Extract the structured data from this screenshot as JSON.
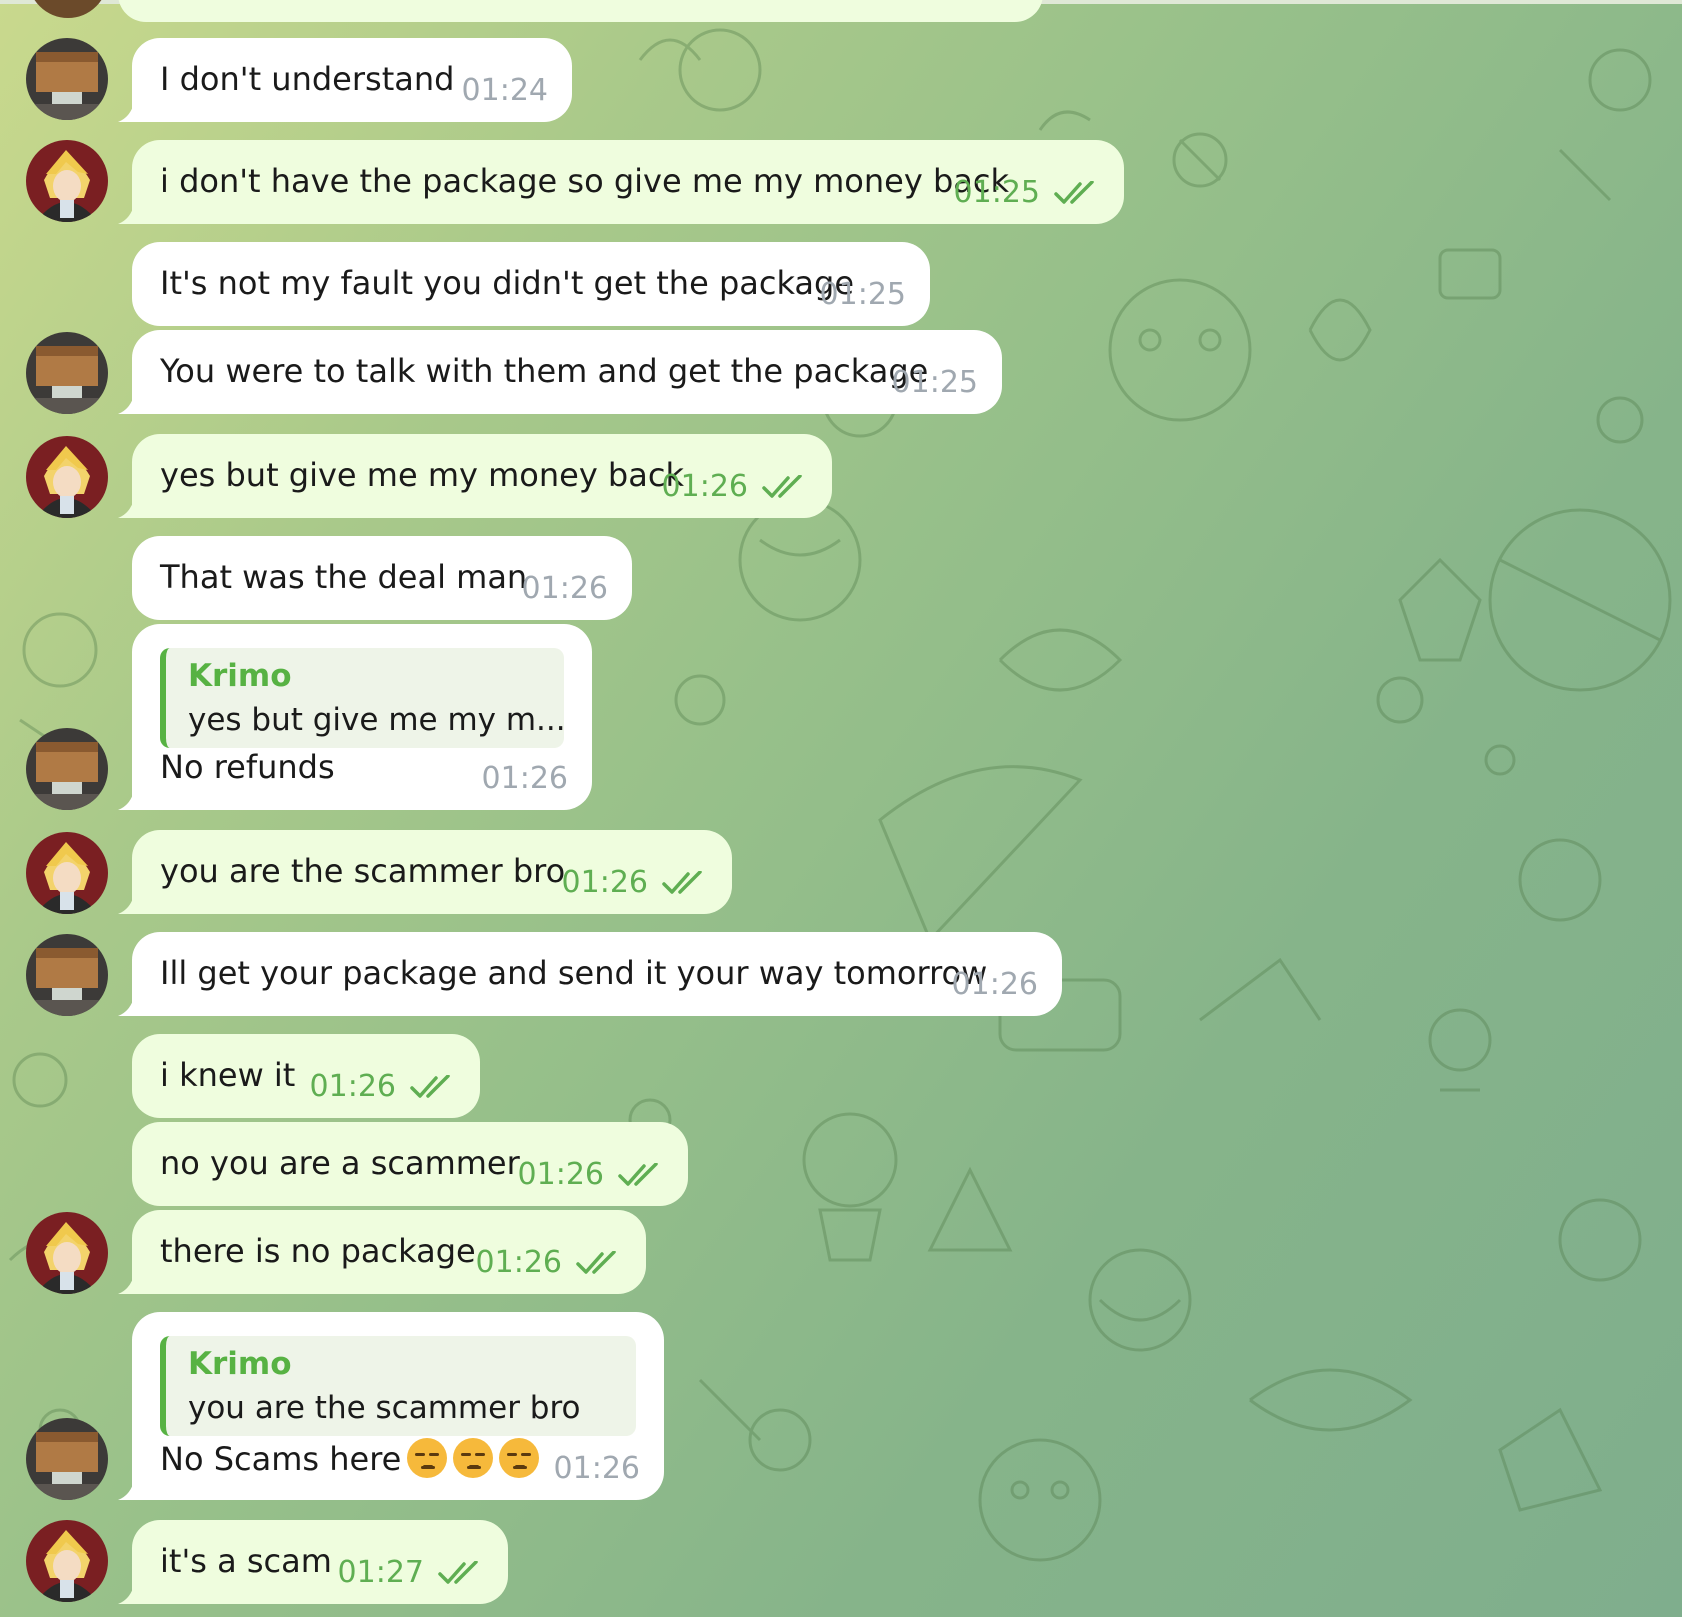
{
  "contacts": {
    "other": {
      "avatar_icon": "avatar-package-photo-icon"
    },
    "me": {
      "avatar_icon": "avatar-anime-character-icon"
    }
  },
  "messages": [
    {
      "id": "m1",
      "text": "I don't understand",
      "time": "01:24",
      "direction": "in"
    },
    {
      "id": "m2",
      "text": "i don't have the package so give me my money back",
      "time": "01:25",
      "direction": "out",
      "status": "read"
    },
    {
      "id": "m3",
      "text": "It's not my fault you didn't get the package",
      "time": "01:25",
      "direction": "in"
    },
    {
      "id": "m4",
      "text": "You were to talk with them and get the package",
      "time": "01:25",
      "direction": "in"
    },
    {
      "id": "m5",
      "text": "yes but give me my money back",
      "time": "01:26",
      "direction": "out",
      "status": "read"
    },
    {
      "id": "m6",
      "text": "That was the deal man",
      "time": "01:26",
      "direction": "in"
    },
    {
      "id": "m7",
      "text": "No refunds",
      "time": "01:26",
      "direction": "in",
      "reply": {
        "name": "Krimo",
        "text": "yes but give me my m..."
      }
    },
    {
      "id": "m8",
      "text": "you are the scammer bro",
      "time": "01:26",
      "direction": "out",
      "status": "read"
    },
    {
      "id": "m9",
      "text": "Ill get your package and send it your way tomorrow",
      "time": "01:26",
      "direction": "in"
    },
    {
      "id": "m10",
      "text": "i knew it",
      "time": "01:26",
      "direction": "out",
      "status": "read"
    },
    {
      "id": "m11",
      "text": "no you are a scammer",
      "time": "01:26",
      "direction": "out",
      "status": "read"
    },
    {
      "id": "m12",
      "text": "there is no package",
      "time": "01:26",
      "direction": "out",
      "status": "read"
    },
    {
      "id": "m13",
      "text": "No Scams here",
      "emoji": [
        "unamused-face",
        "unamused-face",
        "unamused-face"
      ],
      "time": "01:26",
      "direction": "in",
      "reply": {
        "name": "Krimo",
        "text": "you are the scammer bro"
      }
    },
    {
      "id": "m14",
      "text": "it's a scam",
      "time": "01:27",
      "direction": "out",
      "status": "read"
    }
  ],
  "colors": {
    "incoming_bubble": "#ffffff",
    "outgoing_bubble": "#effdde",
    "outgoing_time": "#5fae52",
    "incoming_time": "#a0a8b0",
    "reply_accent": "#57b243"
  }
}
